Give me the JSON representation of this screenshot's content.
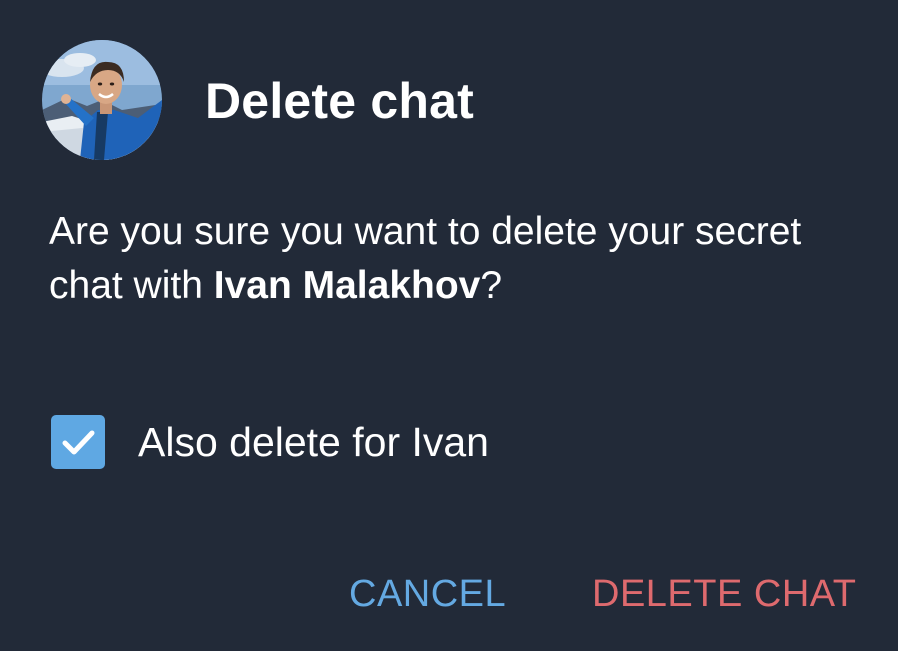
{
  "dialog": {
    "title": "Delete chat",
    "message_prefix": "Are you sure you want to delete your secret chat with ",
    "contact_name": "Ivan Malakhov",
    "message_suffix": "?",
    "checkbox": {
      "label": "Also delete for Ivan",
      "checked": true
    },
    "buttons": {
      "cancel": "CANCEL",
      "delete": "DELETE CHAT"
    }
  },
  "colors": {
    "background": "#222a38",
    "text": "#ffffff",
    "accent_blue": "#64a9e2",
    "checkbox_fill": "#5fa8e3",
    "destructive_red": "#de6a6e"
  },
  "icons": {
    "avatar": "contact-photo",
    "checkbox": "checkmark-icon"
  }
}
